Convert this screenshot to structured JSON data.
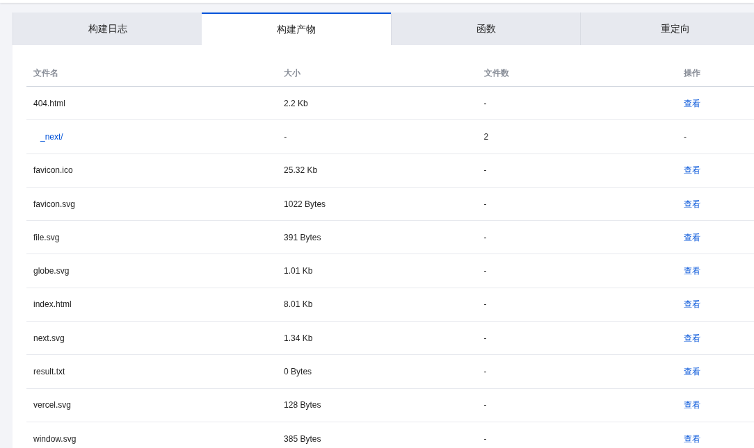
{
  "tabs": [
    {
      "label": "构建日志",
      "selected": false
    },
    {
      "label": "构建产物",
      "selected": true
    },
    {
      "label": "函数",
      "selected": false
    },
    {
      "label": "重定向",
      "selected": false
    }
  ],
  "table": {
    "columns": [
      "文件名",
      "大小",
      "文件数",
      "操作"
    ],
    "rows": [
      {
        "kind": "file",
        "name": "404.html",
        "size": "2.2 Kb",
        "count": "-",
        "action": "查看"
      },
      {
        "kind": "folder",
        "name": "_next/",
        "size": "-",
        "count": "2",
        "action": "-"
      },
      {
        "kind": "file",
        "name": "favicon.ico",
        "size": "25.32 Kb",
        "count": "-",
        "action": "查看"
      },
      {
        "kind": "file",
        "name": "favicon.svg",
        "size": "1022 Bytes",
        "count": "-",
        "action": "查看"
      },
      {
        "kind": "file",
        "name": "file.svg",
        "size": "391 Bytes",
        "count": "-",
        "action": "查看"
      },
      {
        "kind": "file",
        "name": "globe.svg",
        "size": "1.01 Kb",
        "count": "-",
        "action": "查看"
      },
      {
        "kind": "file",
        "name": "index.html",
        "size": "8.01 Kb",
        "count": "-",
        "action": "查看"
      },
      {
        "kind": "file",
        "name": "next.svg",
        "size": "1.34 Kb",
        "count": "-",
        "action": "查看"
      },
      {
        "kind": "file",
        "name": "result.txt",
        "size": "0 Bytes",
        "count": "-",
        "action": "查看"
      },
      {
        "kind": "file",
        "name": "vercel.svg",
        "size": "128 Bytes",
        "count": "-",
        "action": "查看"
      },
      {
        "kind": "file",
        "name": "window.svg",
        "size": "385 Bytes",
        "count": "-",
        "action": "查看"
      }
    ]
  }
}
